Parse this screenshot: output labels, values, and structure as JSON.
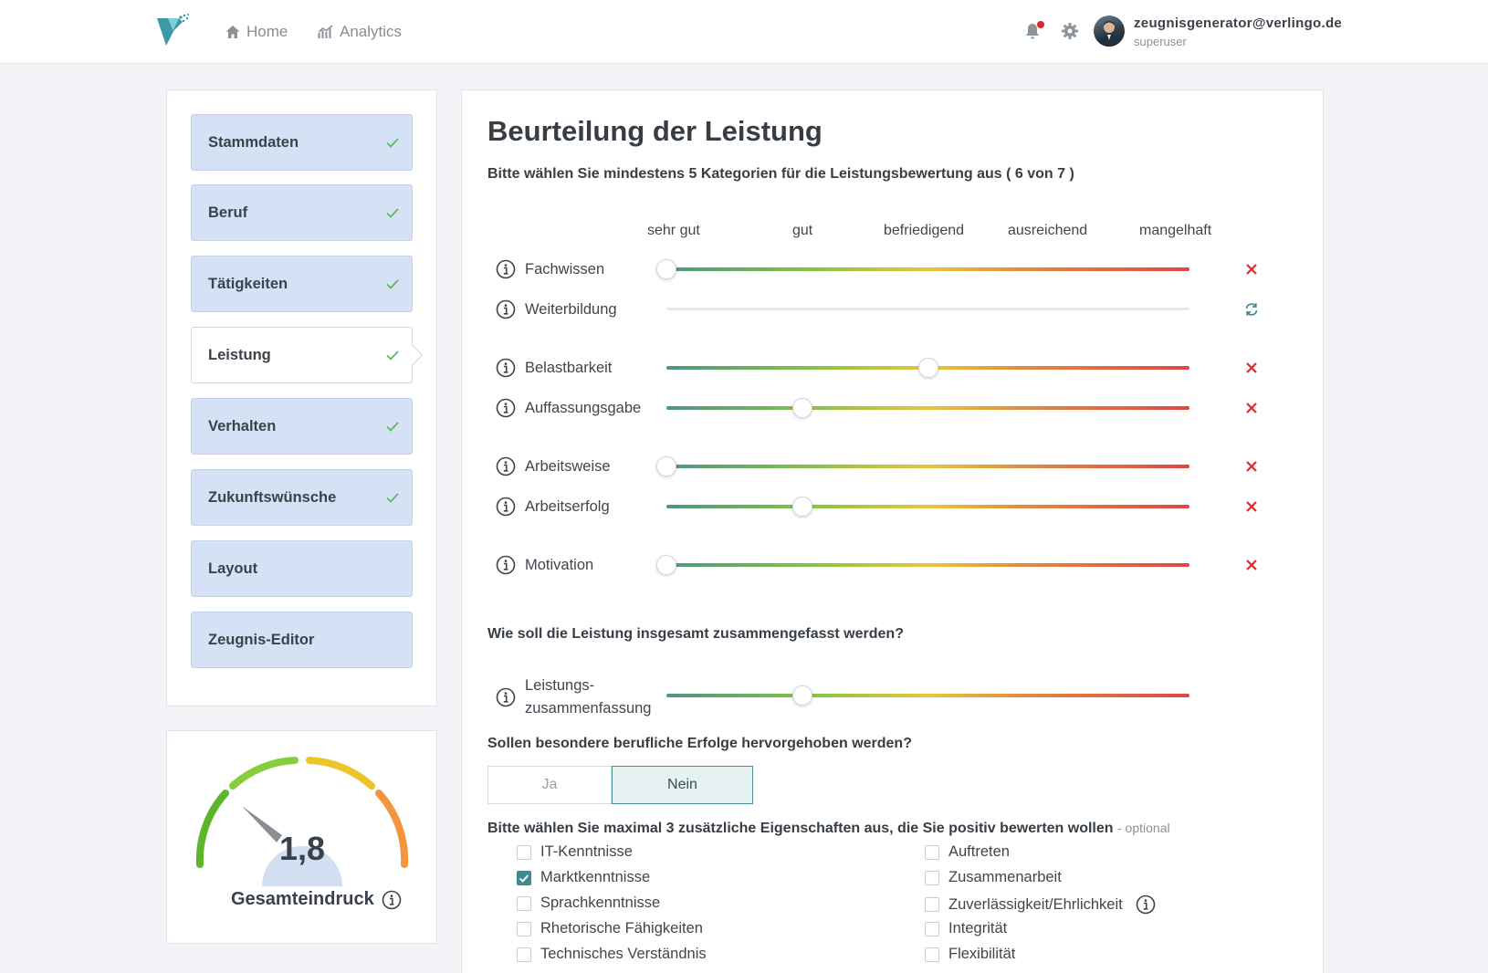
{
  "nav": {
    "home_label": "Home",
    "analytics_label": "Analytics"
  },
  "user": {
    "email": "zeugnisgenerator@verlingo.de",
    "role": "superuser",
    "has_notification": true
  },
  "steps": [
    {
      "label": "Stammdaten",
      "done": true,
      "active": false
    },
    {
      "label": "Beruf",
      "done": true,
      "active": false
    },
    {
      "label": "Tätigkeiten",
      "done": true,
      "active": false
    },
    {
      "label": "Leistung",
      "done": true,
      "active": true
    },
    {
      "label": "Verhalten",
      "done": true,
      "active": false
    },
    {
      "label": "Zukunftswünsche",
      "done": true,
      "active": false
    },
    {
      "label": "Layout",
      "done": false,
      "active": false
    },
    {
      "label": "Zeugnis-Editor",
      "done": false,
      "active": false
    }
  ],
  "gauge": {
    "value": "1,8",
    "label": "Gesamteindruck"
  },
  "main": {
    "title": "Beurteilung der Leistung",
    "instruction": "Bitte wählen Sie mindestens 5 Kategorien für die Leistungsbewertung aus ( 6 von 7 )",
    "scale": [
      "sehr gut",
      "gut",
      "befriedigend",
      "ausreichend",
      "mangelhaft"
    ],
    "ratings": [
      {
        "label": "Fachwissen",
        "value": 0,
        "active": true
      },
      {
        "label": "Weiterbildung",
        "value": null,
        "active": false
      },
      {
        "label": "Belastbarkeit",
        "value": 0.5,
        "active": true
      },
      {
        "label": "Auffassungsgabe",
        "value": 0.26,
        "active": true
      },
      {
        "label": "Arbeitsweise",
        "value": 0,
        "active": true
      },
      {
        "label": "Arbeitserfolg",
        "value": 0.26,
        "active": true
      },
      {
        "label": "Motivation",
        "value": 0,
        "active": true
      }
    ],
    "summary_question": "Wie soll die Leistung insgesamt zusammengefasst werden?",
    "summary": {
      "label_line1": "Leistungs-",
      "label_line2": "zusammenfassung",
      "value": 0.26
    },
    "success_question": "Sollen besondere berufliche Erfolge hervorgehoben werden?",
    "toggle": {
      "yes": "Ja",
      "no": "Nein",
      "selected": "no"
    },
    "extra_question": "Bitte wählen Sie maximal 3 zusätzliche Eigenschaften aus, die Sie positiv bewerten wollen",
    "extra_optional": "- optional",
    "extras_left": [
      {
        "label": "IT-Kenntnisse",
        "checked": false
      },
      {
        "label": "Marktkenntnisse",
        "checked": true
      },
      {
        "label": "Sprachkenntnisse",
        "checked": false
      },
      {
        "label": "Rhetorische Fähigkeiten",
        "checked": false
      },
      {
        "label": "Technisches Verständnis",
        "checked": false
      }
    ],
    "extras_right": [
      {
        "label": "Auftreten",
        "checked": false,
        "info": false
      },
      {
        "label": "Zusammenarbeit",
        "checked": false,
        "info": false
      },
      {
        "label": "Zuverlässigkeit/Ehrlichkeit",
        "checked": false,
        "info": true
      },
      {
        "label": "Integrität",
        "checked": false,
        "info": false
      },
      {
        "label": "Flexibilität",
        "checked": false,
        "info": false
      }
    ]
  },
  "colors": {
    "accent": "#3f8a90",
    "step_bg": "#d5e2f6",
    "remove": "#e02a2a",
    "reset": "#3a8b94"
  }
}
